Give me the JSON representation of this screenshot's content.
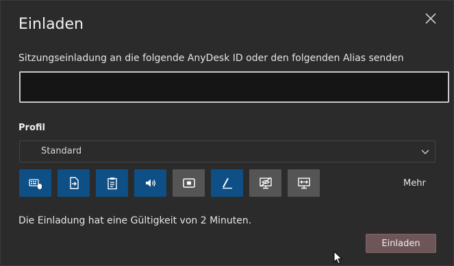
{
  "dialog": {
    "title": "Einladen",
    "instruction": "Sitzungseinladung an die folgende AnyDesk ID oder den folgenden Alias senden",
    "id_input": {
      "value": "",
      "placeholder": ""
    },
    "profile_label": "Profil",
    "profile_selected": "Standard",
    "permissions": [
      {
        "icon": "keyboard-mouse-icon",
        "enabled": true
      },
      {
        "icon": "file-transfer-icon",
        "enabled": true
      },
      {
        "icon": "clipboard-icon",
        "enabled": true
      },
      {
        "icon": "speaker-icon",
        "enabled": true
      },
      {
        "icon": "screen-record-icon",
        "enabled": false
      },
      {
        "icon": "whiteboard-pen-icon",
        "enabled": true
      },
      {
        "icon": "privacy-mode-icon",
        "enabled": false
      },
      {
        "icon": "display-switch-icon",
        "enabled": false
      }
    ],
    "more_label": "Mehr",
    "validity_text": "Die Einladung hat eine Gültigkeit von 2 Minuten.",
    "invite_button": "Einladen"
  },
  "colors": {
    "permission_on": "#0e4f86",
    "permission_off": "#555555",
    "invite_button": "#6e5558"
  }
}
